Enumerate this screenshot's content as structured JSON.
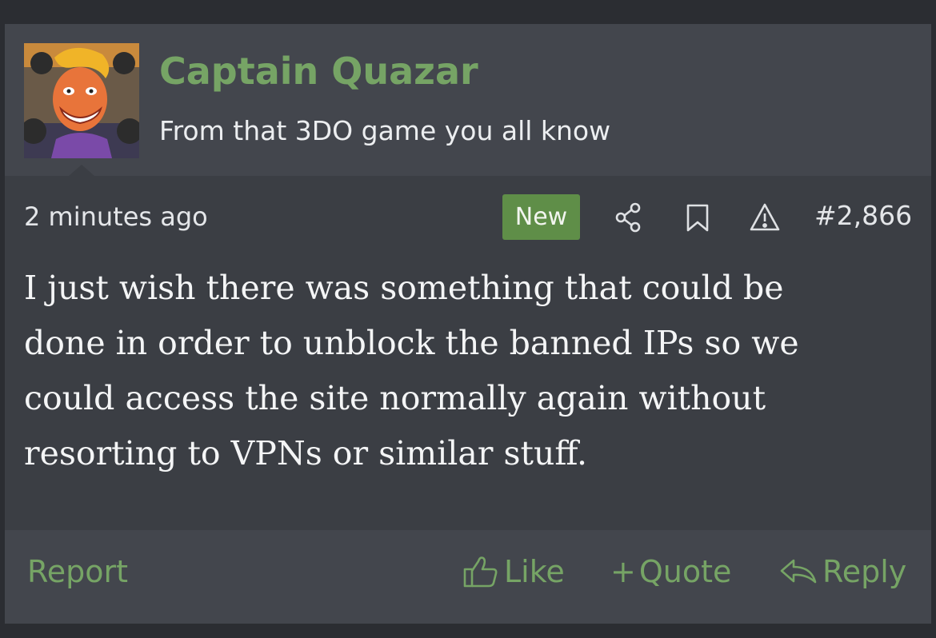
{
  "post": {
    "author": {
      "name": "Captain Quazar",
      "title": "From that 3DO game you all know",
      "avatar_icon": "avatar-image"
    },
    "meta": {
      "time": "2 minutes ago",
      "badge": "New",
      "number": "#2,866",
      "icons": [
        "share-icon",
        "bookmark-icon",
        "warning-icon"
      ]
    },
    "body": {
      "lines": [
        "I just wish there was something that could be",
        "done in order to unblock the banned IPs so we",
        "could access the site normally again without",
        "resorting to VPNs or similar stuff."
      ]
    },
    "actions": {
      "report": "Report",
      "like": "Like",
      "quote_plus": "+",
      "quote": "Quote",
      "reply": "Reply"
    },
    "colors": {
      "accent": "#76a465",
      "badge_bg": "#5f8e48",
      "panel": "#3b3e44",
      "header": "#43464d"
    }
  }
}
